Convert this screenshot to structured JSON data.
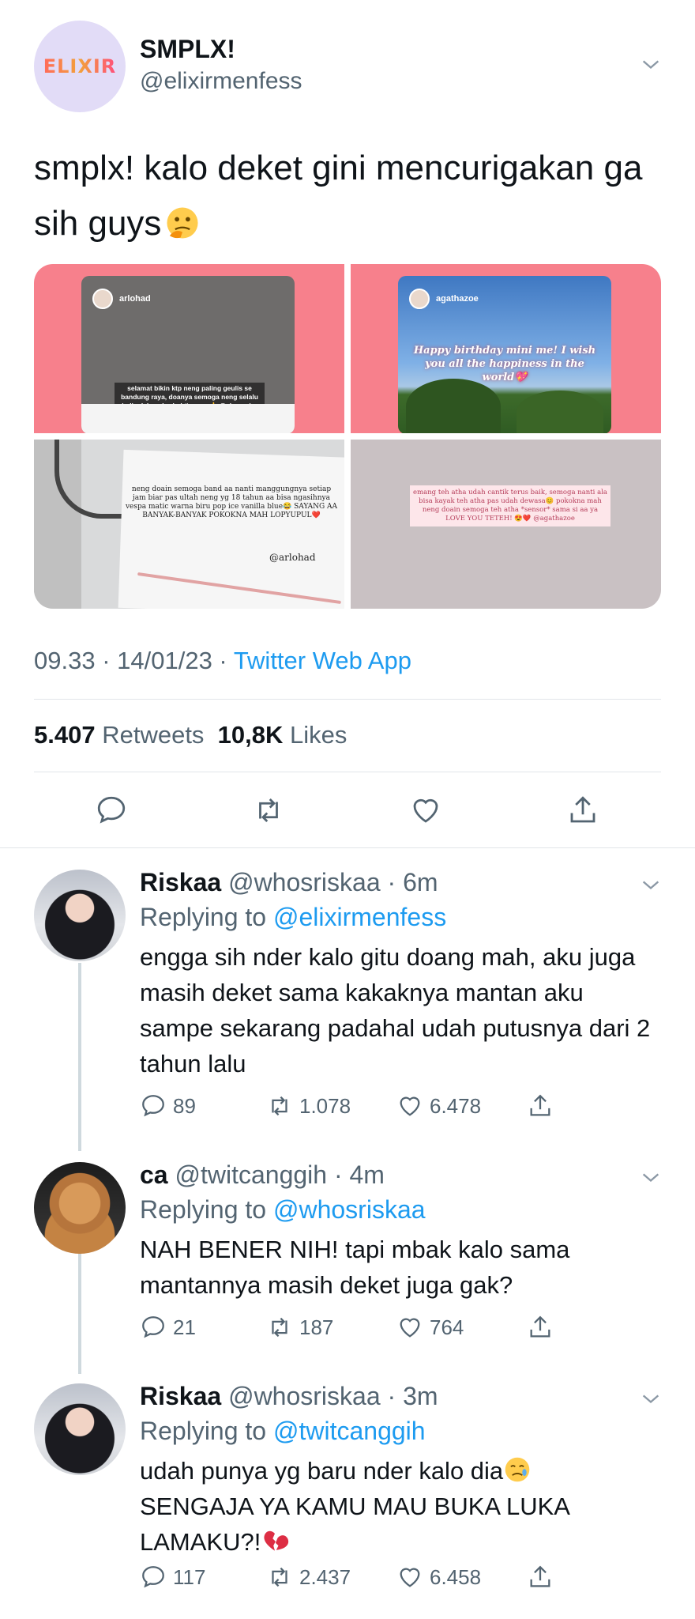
{
  "main_tweet": {
    "display_name": "SMPLX!",
    "handle": "@elixirmenfess",
    "avatar_logo_text": "ELIXIR",
    "text": "smplx! kalo deket gini mencurigakan ga sih guys",
    "text_emoji": "thinking-face",
    "media": {
      "image1": {
        "story_user": "arlohad",
        "caption": "selamat bikin ktp neng paling geulis se bandung raya, doanya semoga neng selalu jadi adek yg berbakti sm aa👍 @alanamira"
      },
      "image2": {
        "story_user": "agathazoe",
        "caption": "Happy birthday mini me! I wish you all the happiness in the world💖"
      },
      "image3": {
        "note": "neng doain semoga band aa nanti manggungnya setiap jam biar pas ultah neng yg 18 tahun aa bisa ngasihnya vespa matic warna biru pop ice vanilla blue😂 SAYANG AA BANYAK-BANYAK POKOKNA MAH LOPYUPUL❤️",
        "signature": "@arlohad"
      },
      "image4": {
        "card": "emang teh atha udah cantik terus baik, semoga nanti ala bisa kayak teh atha pas udah dewasa😊 pokokna mah neng doain semoga teh atha *sensor* sama si aa ya LOVE YOU TETEH! 😍❤️ @agathazoe"
      }
    },
    "time": "09.33",
    "date": "14/01/23",
    "source": "Twitter Web App",
    "retweets_count": "5.407",
    "retweets_label": "Retweets",
    "likes_count": "10,8K",
    "likes_label": "Likes"
  },
  "replies": [
    {
      "display_name": "Riskaa",
      "handle": "@whosriskaa",
      "time": "6m",
      "replying_prefix": "Replying to",
      "replying_to": "@elixirmenfess",
      "text": "engga sih nder kalo gitu doang mah, aku juga masih deket sama kakaknya mantan aku sampe sekarang padahal udah putusnya dari 2 tahun lalu",
      "replies": "89",
      "retweets": "1.078",
      "likes": "6.478"
    },
    {
      "display_name": "ca",
      "handle": "@twitcanggih",
      "time": "4m",
      "replying_prefix": "Replying to",
      "replying_to": "@whosriskaa",
      "text": "NAH BENER NIH! tapi mbak kalo sama mantannya masih deket juga gak?",
      "replies": "21",
      "retweets": "187",
      "likes": "764"
    },
    {
      "display_name": "Riskaa",
      "handle": "@whosriskaa",
      "time": "3m",
      "replying_prefix": "Replying to",
      "replying_to": "@twitcanggih",
      "text_line1": "udah punya yg baru nder kalo dia",
      "text_rest": "SENGAJA YA KAMU MAU BUKA LUKA LAMAKU?!",
      "emoji_1": "crying-face",
      "emoji_2": "broken-heart",
      "replies": "117",
      "retweets": "2.437",
      "likes": "6.458"
    }
  ],
  "colors": {
    "link": "#1d9bf0",
    "secondary_text": "#536471",
    "primary_text": "#0f1419",
    "media_pink": "#f7808c"
  }
}
